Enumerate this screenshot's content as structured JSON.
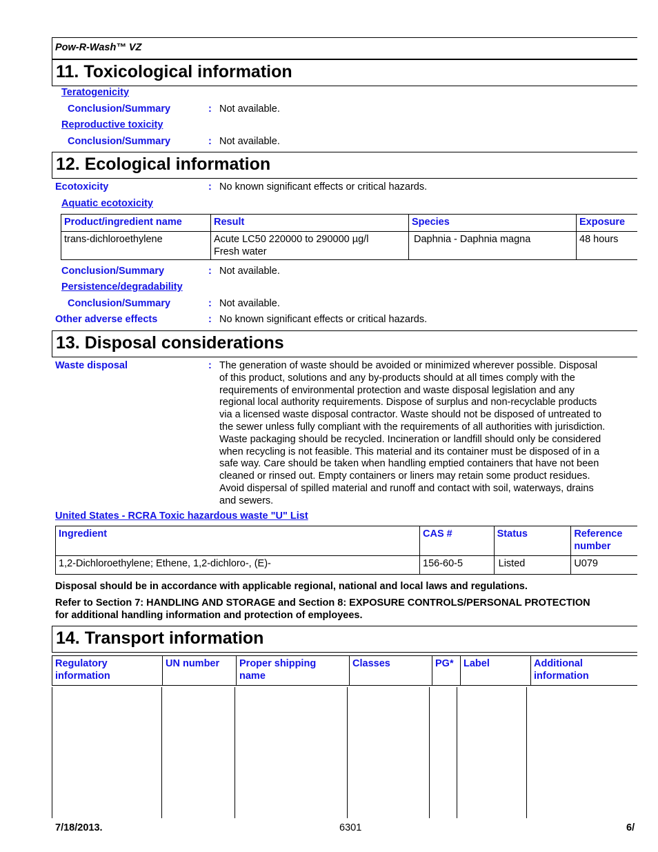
{
  "header": {
    "product_name": "Pow-R-Wash™ VZ"
  },
  "section11": {
    "title": "11. Toxicological information",
    "teratogenicity": {
      "heading": "Teratogenicity",
      "label": "Conclusion/Summary",
      "value": "Not available."
    },
    "reproductive": {
      "heading": "Reproductive toxicity",
      "label": "Conclusion/Summary",
      "value": "Not available."
    }
  },
  "section12": {
    "title": "12. Ecological information",
    "ecotoxicity": {
      "label": "Ecotoxicity",
      "value": "No known significant effects or critical hazards."
    },
    "aquatic": {
      "heading": "Aquatic ecotoxicity",
      "columns": [
        "Product/ingredient name",
        "Result",
        "Species",
        "Exposure"
      ],
      "rows": [
        {
          "name": "trans-dichloroethylene",
          "result_line1": "Acute LC50 220000 to 290000 µg/l",
          "result_line2": "Fresh water",
          "species": "Daphnia - Daphnia magna",
          "exposure": "48 hours"
        }
      ],
      "conclusion_label": "Conclusion/Summary",
      "conclusion_value": "Not available."
    },
    "persistence": {
      "heading": "Persistence/degradability",
      "label": "Conclusion/Summary",
      "value": "Not available."
    },
    "other": {
      "label": "Other adverse effects",
      "value": "No known significant effects or critical hazards."
    }
  },
  "section13": {
    "title": "13. Disposal considerations",
    "waste": {
      "label": "Waste disposal",
      "lines": [
        "The generation of waste should be avoided or minimized wherever possible.  Disposal",
        "of this product, solutions and any by-products should at all times comply with the",
        "requirements of environmental protection and waste disposal legislation and any",
        "regional local authority requirements.  Dispose of surplus and non-recyclable products",
        "via a licensed waste disposal contractor.  Waste should not be disposed of untreated to",
        "the sewer unless fully compliant with the requirements of all authorities with jurisdiction.",
        "Waste packaging should be recycled.  Incineration or landfill should only be considered",
        "when recycling is not feasible.  This material and its container must be disposed of in a",
        "safe way.  Care should be taken when handling emptied containers that have not been",
        "cleaned or rinsed out.  Empty containers or liners may retain some product residues.",
        "Avoid dispersal of spilled material and runoff and contact with soil, waterways, drains",
        "and sewers."
      ]
    },
    "rcra": {
      "heading": "United States - RCRA Toxic hazardous waste \"U\" List",
      "columns": [
        "Ingredient",
        "CAS #",
        "Status",
        "Reference number"
      ],
      "rows": [
        {
          "ingredient": "1,2-Dichloroethylene; Ethene, 1,2-dichloro-, (E)-",
          "cas": "156-60-5",
          "status": "Listed",
          "reference": "U079"
        }
      ]
    },
    "note1": "Disposal should be in accordance with applicable regional, national and local laws and regulations.",
    "note2_line1": "Refer to Section 7: HANDLING AND STORAGE and Section 8: EXPOSURE CONTROLS/PERSONAL PROTECTION",
    "note2_line2": "for additional handling information and protection of employees."
  },
  "section14": {
    "title": "14. Transport information",
    "columns": [
      {
        "line1": "Regulatory",
        "line2": "information"
      },
      {
        "line1": "UN number",
        "line2": ""
      },
      {
        "line1": "Proper shipping",
        "line2": "name"
      },
      {
        "line1": "Classes",
        "line2": ""
      },
      {
        "line1": "PG*",
        "line2": ""
      },
      {
        "line1": "Label",
        "line2": ""
      },
      {
        "line1": "Additional",
        "line2": "information"
      }
    ]
  },
  "footer": {
    "date": "7/18/2013.",
    "code": "6301",
    "page": "6/"
  }
}
